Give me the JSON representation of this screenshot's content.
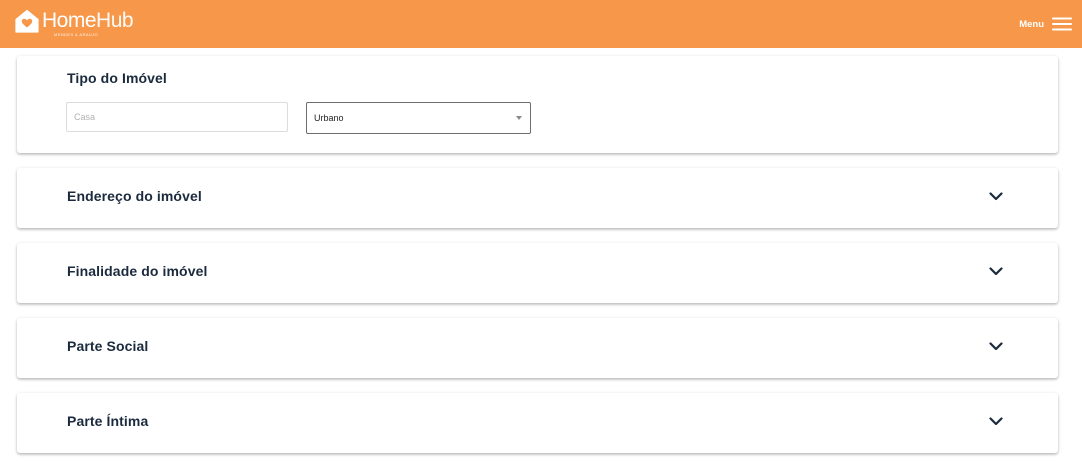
{
  "header": {
    "logo_name_home": "Home",
    "logo_name_hub": "Hub",
    "logo_tagline": "MENDES & ARAUJO",
    "logo_icon": "house-heart-icon",
    "menu_label": "Menu",
    "menu_icon": "hamburger-icon",
    "bg_color": "#f7974a"
  },
  "tipo_imovel": {
    "title": "Tipo do Imóvel",
    "type_input": {
      "placeholder": "Casa",
      "value": ""
    },
    "zone_select": {
      "value": "Urbano"
    }
  },
  "sections": [
    {
      "title": "Endereço do imóvel",
      "icon": "chevron-down-icon"
    },
    {
      "title": "Finalidade do imóvel",
      "icon": "chevron-down-icon"
    },
    {
      "title": "Parte Social",
      "icon": "chevron-down-icon"
    },
    {
      "title": "Parte Íntima",
      "icon": "chevron-down-icon"
    }
  ]
}
